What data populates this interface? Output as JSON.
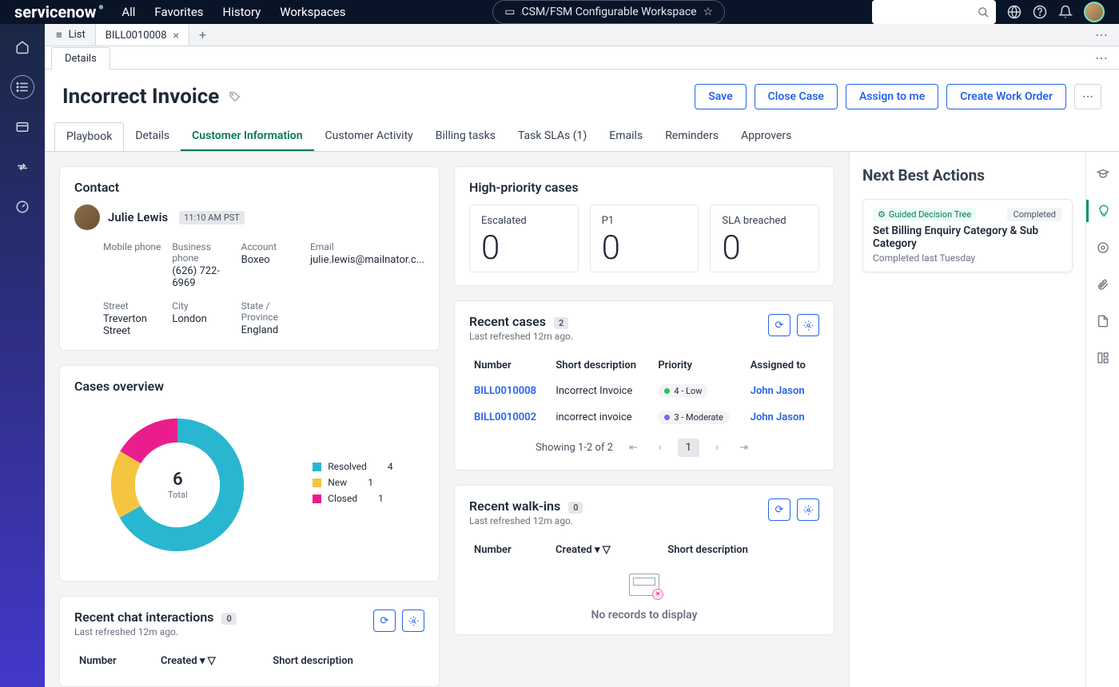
{
  "topnav": {
    "logo": "servicenow",
    "links": [
      "All",
      "Favorites",
      "History",
      "Workspaces"
    ],
    "workspace": "CSM/FSM Configurable Workspace"
  },
  "tabs": {
    "list": "List",
    "record": "BILL0010008",
    "details": "Details"
  },
  "page": {
    "title": "Incorrect Invoice",
    "actions": {
      "save": "Save",
      "close": "Close Case",
      "assign": "Assign to me",
      "workorder": "Create Work Order"
    }
  },
  "recordTabs": [
    "Playbook",
    "Details",
    "Customer Information",
    "Customer Activity",
    "Billing tasks",
    "Task SLAs (1)",
    "Emails",
    "Reminders",
    "Approvers"
  ],
  "contact": {
    "title": "Contact",
    "name": "Julie Lewis",
    "time": "11:10 AM PST",
    "fields": {
      "mobile": {
        "label": "Mobile phone",
        "value": ""
      },
      "business": {
        "label": "Business phone",
        "value": "(626) 722-6969"
      },
      "account": {
        "label": "Account",
        "value": "Boxeo"
      },
      "email": {
        "label": "Email",
        "value": "julie.lewis@mailnator.c..."
      },
      "street": {
        "label": "Street",
        "value": "Treverton Street"
      },
      "city": {
        "label": "City",
        "value": "London"
      },
      "state": {
        "label": "State / Province",
        "value": "England"
      }
    }
  },
  "hpc": {
    "title": "High-priority cases",
    "items": [
      {
        "label": "Escalated",
        "value": "0"
      },
      {
        "label": "P1",
        "value": "0"
      },
      {
        "label": "SLA breached",
        "value": "0"
      }
    ]
  },
  "overview": {
    "title": "Cases overview",
    "total": "6",
    "totalLabel": "Total",
    "legend": [
      {
        "label": "Resolved",
        "count": "4",
        "color": "#29b6d1"
      },
      {
        "label": "New",
        "count": "1",
        "color": "#f5c542"
      },
      {
        "label": "Closed",
        "count": "1",
        "color": "#e91e8c"
      }
    ]
  },
  "recentCases": {
    "title": "Recent cases",
    "count": "2",
    "refreshed": "Last refreshed 12m ago.",
    "cols": [
      "Number",
      "Short description",
      "Priority",
      "Assigned to"
    ],
    "rows": [
      {
        "num": "BILL0010008",
        "desc": "Incorrect Invoice",
        "prio": "4 - Low",
        "prioColor": "green",
        "assigned": "John Jason"
      },
      {
        "num": "BILL0010002",
        "desc": "incorrect invoice",
        "prio": "3 - Moderate",
        "prioColor": "purple",
        "assigned": "John Jason"
      }
    ],
    "pager": "Showing 1-2 of 2",
    "page": "1"
  },
  "walkins": {
    "title": "Recent walk-ins",
    "count": "0",
    "refreshed": "Last refreshed 12m ago.",
    "cols": [
      "Number",
      "Created",
      "Short description"
    ],
    "empty": "No records to display"
  },
  "chat": {
    "title": "Recent chat interactions",
    "count": "0",
    "refreshed": "Last refreshed 12m ago.",
    "cols": [
      "Number",
      "Created",
      "Short description"
    ]
  },
  "nextBest": {
    "title": "Next Best Actions",
    "card": {
      "tag": "Guided Decision Tree",
      "status": "Completed",
      "title": "Set Billing Enquiry Category & Sub Category",
      "sub": "Completed last Tuesday"
    }
  },
  "chart_data": {
    "type": "pie",
    "title": "Cases overview",
    "categories": [
      "Resolved",
      "New",
      "Closed"
    ],
    "values": [
      4,
      1,
      1
    ],
    "colors": [
      "#29b6d1",
      "#f5c542",
      "#e91e8c"
    ],
    "total": 6
  }
}
